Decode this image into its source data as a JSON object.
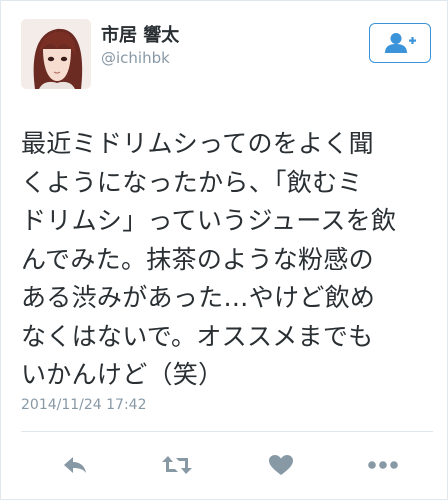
{
  "user": {
    "display_name": "市居 響太",
    "handle": "@ichihbk",
    "avatar_icon": "user-avatar-illustration",
    "follow_icon": "add-user-icon"
  },
  "tweet": {
    "lines": [
      "最近ミドリムシってのをよく聞",
      "くようになったから、「飲むミ",
      "ドリムシ」っていうジュースを飲",
      "んでみた。抹茶のような粉感の",
      "ある渋みがあった…やけど飲め",
      "なくはないで。オススメまでも",
      "いかんけど（笑）"
    ],
    "timestamp": "2014/11/24 17:42"
  },
  "actions": {
    "reply_icon": "reply-icon",
    "retweet_icon": "retweet-icon",
    "favorite_icon": "heart-icon",
    "more_icon": "more-icon"
  },
  "colors": {
    "accent": "#3b94d9",
    "text": "#292f33",
    "muted": "#8899a6",
    "icon": "#8899a6",
    "border": "#e1e8ed"
  }
}
